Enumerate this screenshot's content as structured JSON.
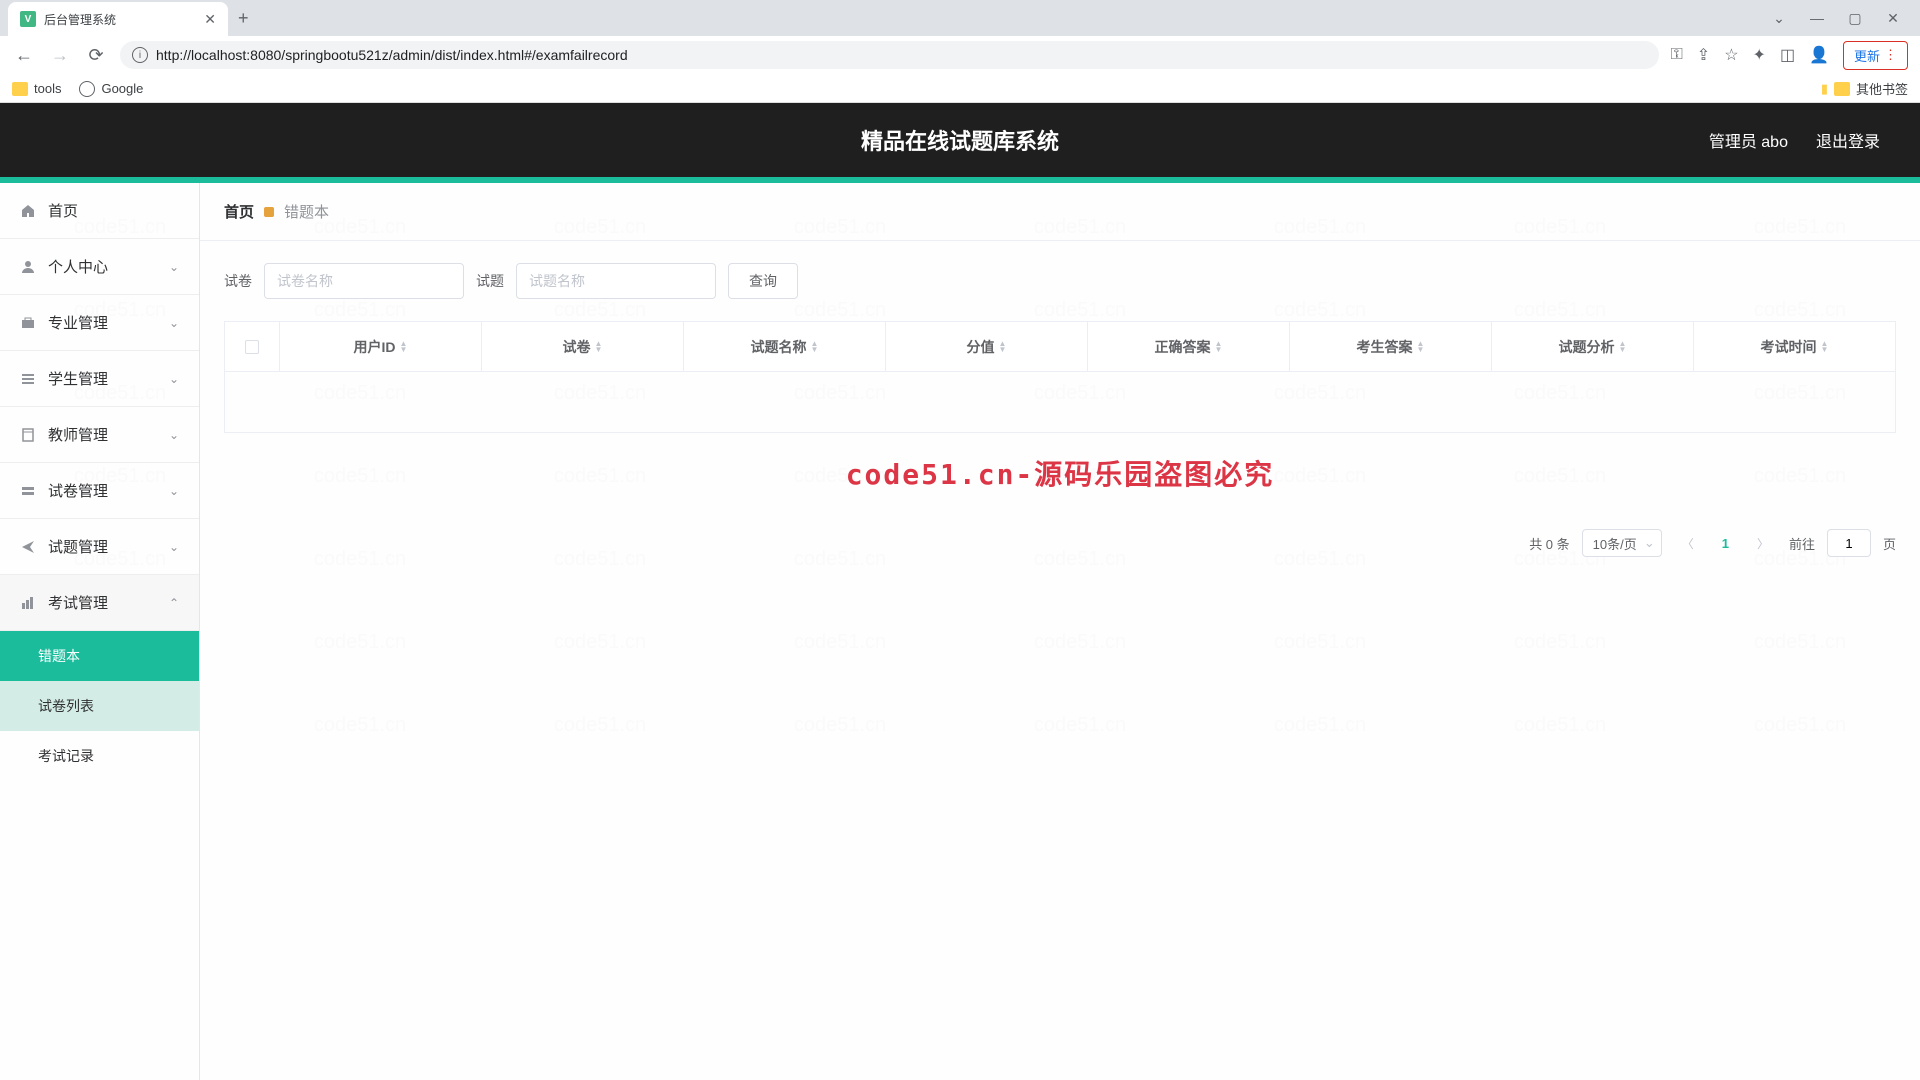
{
  "browser": {
    "tab_title": "后台管理系统",
    "url": "http://localhost:8080/springbootu521z/admin/dist/index.html#/examfailrecord",
    "update_label": "更新",
    "bookmarks": {
      "tools": "tools",
      "google": "Google",
      "other": "其他书签"
    }
  },
  "header": {
    "title": "精品在线试题库系统",
    "user_label": "管理员 abo",
    "logout": "退出登录"
  },
  "sidebar": {
    "home": "首页",
    "personal": "个人中心",
    "major": "专业管理",
    "student": "学生管理",
    "teacher": "教师管理",
    "paper": "试卷管理",
    "question": "试题管理",
    "exam": "考试管理",
    "sub_wrong": "错题本",
    "sub_paperlist": "试卷列表",
    "sub_record": "考试记录"
  },
  "breadcrumb": {
    "home": "首页",
    "current": "错题本"
  },
  "search": {
    "paper_label": "试卷",
    "paper_placeholder": "试卷名称",
    "question_label": "试题",
    "question_placeholder": "试题名称",
    "button": "查询"
  },
  "table": {
    "user_id": "用户ID",
    "paper": "试卷",
    "question_name": "试题名称",
    "score": "分值",
    "correct": "正确答案",
    "student_answer": "考生答案",
    "analysis": "试题分析",
    "exam_time": "考试时间"
  },
  "watermark_notice": "code51.cn-源码乐园盗图必究",
  "watermark_text": "code51.cn",
  "pagination": {
    "total": "共 0 条",
    "per_page": "10条/页",
    "current": "1",
    "goto_prefix": "前往",
    "goto_value": "1",
    "goto_suffix": "页"
  }
}
